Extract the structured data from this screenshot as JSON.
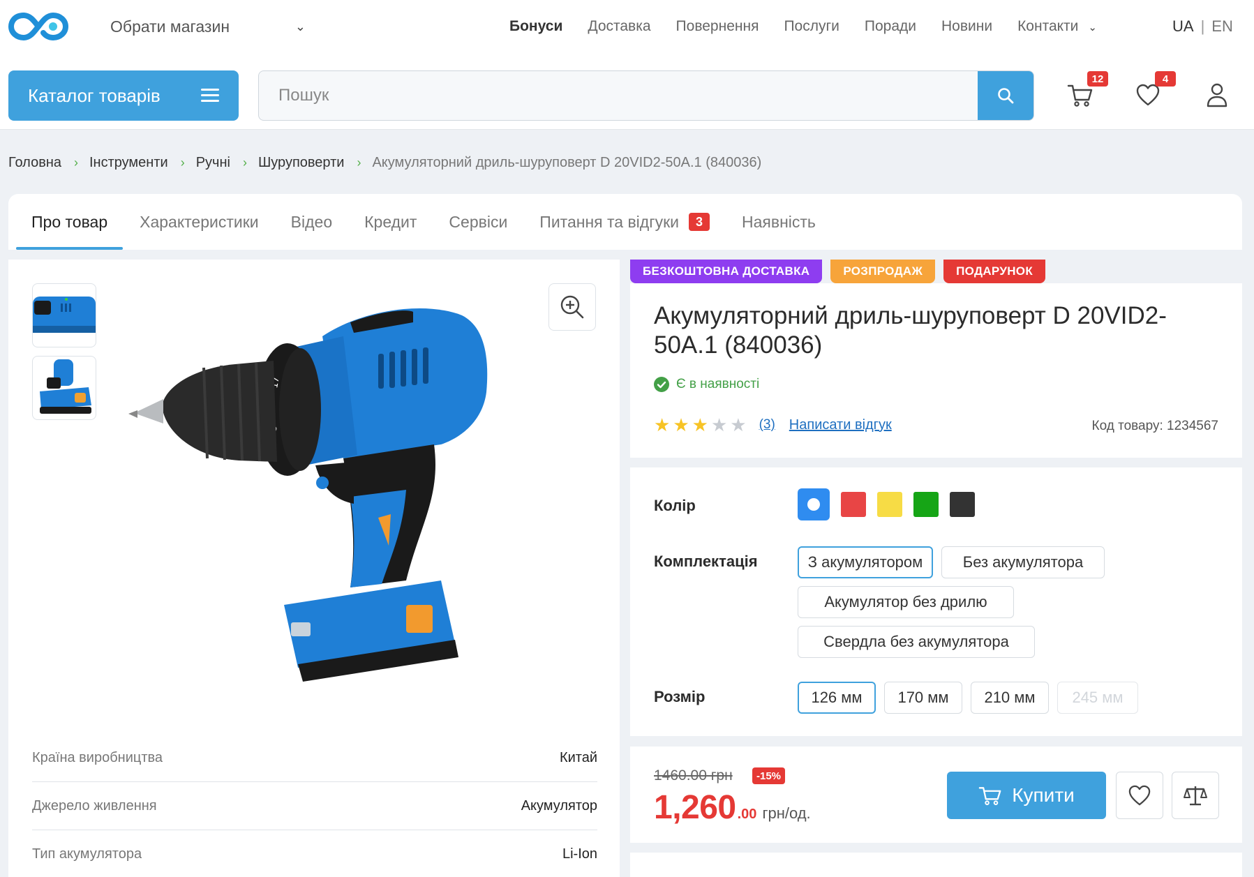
{
  "header": {
    "store_select": "Обрати магазин",
    "nav": [
      "Бонуси",
      "Доставка",
      "Повернення",
      "Послуги",
      "Поради",
      "Новини",
      "Контакти"
    ],
    "lang_active": "UA",
    "lang_other": "EN",
    "catalog_label": "Каталог товарів",
    "search_placeholder": "Пошук",
    "cart_count": "12",
    "wishlist_count": "4"
  },
  "breadcrumb": [
    "Головна",
    "Інструменти",
    "Ручні",
    "Шуруповерти",
    "Акумуляторний дриль-шуруповерт D 20VID2-50A.1 (840036)"
  ],
  "tabs": {
    "about": "Про товар",
    "specs": "Характеристики",
    "video": "Відео",
    "credit": "Кредит",
    "services": "Сервіси",
    "qa": "Питання та відгуки",
    "qa_count": "3",
    "availability": "Наявність"
  },
  "gallery": {
    "specs": [
      {
        "key": "Країна виробництва",
        "value": "Китай"
      },
      {
        "key": "Джерело живлення",
        "value": "Акумулятор"
      },
      {
        "key": "Тип акумулятора",
        "value": "Li-Ion"
      }
    ]
  },
  "product": {
    "labels": {
      "free_delivery": "БЕЗКОШТОВНА ДОСТАВКА",
      "sale": "РОЗПРОДАЖ",
      "gift": "ПОДАРУНОК"
    },
    "label_colors": {
      "free_delivery": "#8e3df0",
      "sale": "#f7a43a",
      "gift": "#e53935"
    },
    "title": "Акумуляторний дриль-шуруповерт D 20VID2-50A.1 (840036)",
    "stock": "Є в наявності",
    "rating": 3,
    "rating_max": 5,
    "reviews_count": "(3)",
    "write_review": "Написати відгук",
    "sku": "Код товару: 1234567"
  },
  "options": {
    "color_label": "Колір",
    "colors": [
      "#2f8cf0",
      "#e84545",
      "#f7dc45",
      "#16a516",
      "#333333"
    ],
    "selected_color": "#2f8cf0",
    "kit_label": "Комплектація",
    "kits": [
      "З акумулятором",
      "Без акумулятора",
      "Акумулятор без дрилю",
      "Свердла без акумулятора"
    ],
    "size_label": "Розмір",
    "sizes": [
      "126 мм",
      "170 мм",
      "210 мм",
      "245 мм"
    ]
  },
  "price": {
    "old": "1460.00 грн",
    "discount": "-15%",
    "current_int": "1,260",
    "current_dec": ".00",
    "unit": "грн/од.",
    "buy_label": "Купити"
  },
  "colors": {
    "accent": "#3fa1dd",
    "price": "#e53935",
    "link": "#1e6fc0",
    "stock": "#43a047"
  }
}
